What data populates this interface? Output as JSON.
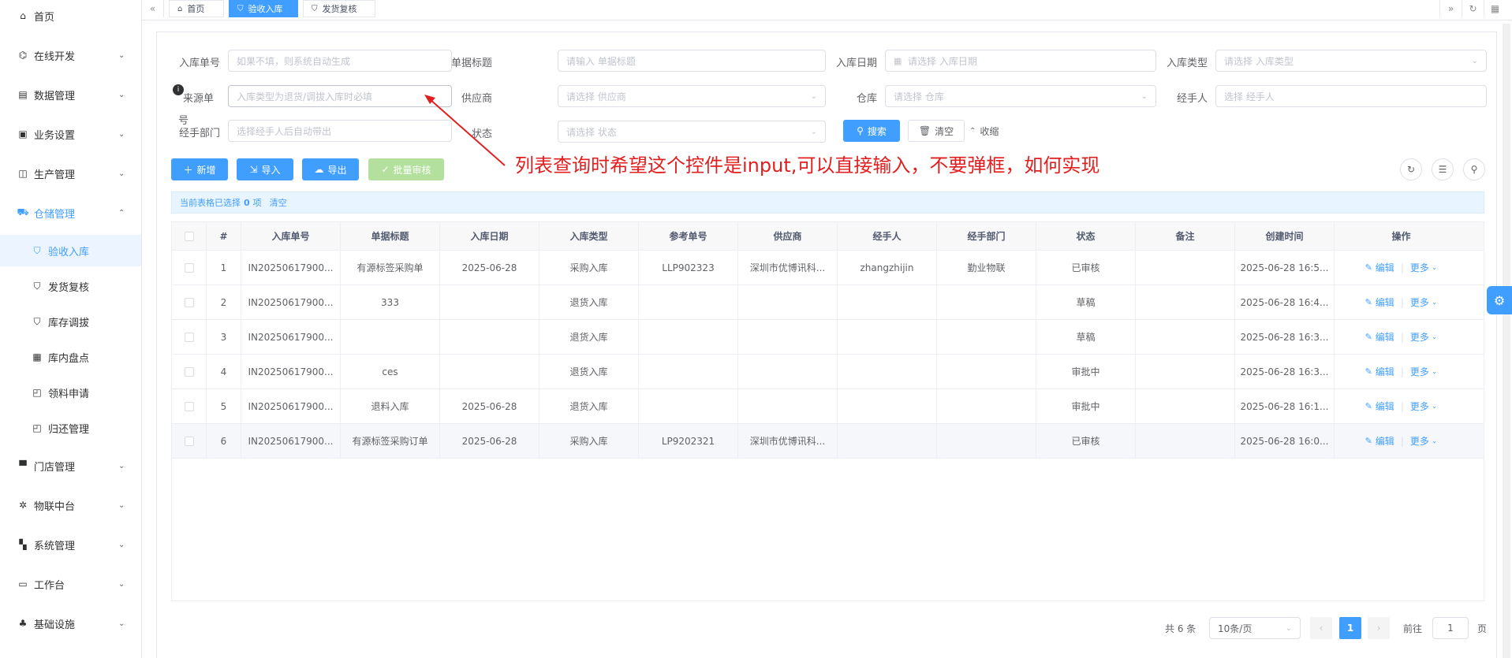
{
  "sidebar": {
    "items": [
      {
        "icon": "home-icon",
        "glyph": "⌂",
        "label": "首页",
        "expandable": false
      },
      {
        "icon": "code-icon",
        "glyph": "⌬",
        "label": "在线开发",
        "expandable": true
      },
      {
        "icon": "database-icon",
        "glyph": "▤",
        "label": "数据管理",
        "expandable": true
      },
      {
        "icon": "briefcase-icon",
        "glyph": "▣",
        "label": "业务设置",
        "expandable": true
      },
      {
        "icon": "factory-icon",
        "glyph": "◫",
        "label": "生产管理",
        "expandable": true
      },
      {
        "icon": "warehouse-icon",
        "glyph": "⛟",
        "label": "仓储管理",
        "expandable": true,
        "open": true
      },
      {
        "icon": "cart-icon",
        "glyph": "⛉",
        "label": "验收入库",
        "sub": true,
        "active": true
      },
      {
        "icon": "cart-icon",
        "glyph": "⛉",
        "label": "发货复核",
        "sub": true
      },
      {
        "icon": "cart-icon",
        "glyph": "⛉",
        "label": "库存调拔",
        "sub": true
      },
      {
        "icon": "calendar-icon",
        "glyph": "▦",
        "label": "库内盘点",
        "sub": true
      },
      {
        "icon": "bag-icon",
        "glyph": "◰",
        "label": "领料申请",
        "sub": true
      },
      {
        "icon": "bag-icon",
        "glyph": "◰",
        "label": "归还管理",
        "sub": true
      },
      {
        "icon": "store-icon",
        "glyph": "▀",
        "label": "门店管理",
        "expandable": true
      },
      {
        "icon": "iot-icon",
        "glyph": "✲",
        "label": "物联中台",
        "expandable": true
      },
      {
        "icon": "grid-icon",
        "glyph": "▚",
        "label": "系统管理",
        "expandable": true
      },
      {
        "icon": "monitor-icon",
        "glyph": "▭",
        "label": "工作台",
        "expandable": true
      },
      {
        "icon": "infrastructure-icon",
        "glyph": "♣",
        "label": "基础设施",
        "expandable": true
      }
    ]
  },
  "tabs": [
    {
      "label": "首页",
      "icon": "home-icon",
      "glyph": "⌂"
    },
    {
      "label": "验收入库",
      "icon": "cart-icon",
      "glyph": "⛉",
      "active": true
    },
    {
      "label": "发货复核",
      "icon": "cart-icon",
      "glyph": "⛉"
    }
  ],
  "filters": {
    "inbound_no": {
      "label": "入库单号",
      "placeholder": "如果不填，则系统自动生成"
    },
    "doc_title": {
      "label": "单据标题",
      "placeholder": "请输入 单据标题"
    },
    "inbound_date": {
      "label": "入库日期",
      "placeholder": "请选择 入库日期"
    },
    "inbound_type": {
      "label": "入库类型",
      "placeholder": "请选择 入库类型"
    },
    "source_no": {
      "label_1": "来源单",
      "label_2": "号",
      "placeholder": "入库类型为退货/调拔入库时必填"
    },
    "supplier": {
      "label": "供应商",
      "placeholder": "请选择 供应商"
    },
    "warehouse": {
      "label": "仓库",
      "placeholder": "请选择 仓库"
    },
    "handler": {
      "label": "经手人",
      "placeholder": "选择 经手人"
    },
    "handler_dept": {
      "label": "经手部门",
      "placeholder": "选择经手人后自动带出"
    },
    "status": {
      "label": "状态",
      "placeholder": "请选择 状态"
    },
    "search_label": "搜索",
    "clear_label": "清空",
    "collapse_label": "收缩"
  },
  "toolbar": {
    "add_label": "新增",
    "import_label": "导入",
    "export_label": "导出",
    "batch_audit_label": "批量审核"
  },
  "annotation": "列表查询时希望这个控件是input,可以直接输入，不要弹框，如何实现",
  "selection": {
    "prefix": "当前表格已选择",
    "count": "0",
    "suffix": "项",
    "clear": "清空"
  },
  "table": {
    "columns": [
      "#",
      "入库单号",
      "单据标题",
      "入库日期",
      "入库类型",
      "参考单号",
      "供应商",
      "经手人",
      "经手部门",
      "状态",
      "备注",
      "创建时间",
      "操作"
    ],
    "rows": [
      [
        "1",
        "IN20250617900...",
        "有源标签采购单",
        "2025-06-28",
        "采购入库",
        "LLP902323",
        "深圳市优博讯科...",
        "zhangzhijin",
        "勤业物联",
        "已审核",
        "",
        "2025-06-28 16:5..."
      ],
      [
        "2",
        "IN20250617900...",
        "333",
        "",
        "退货入库",
        "",
        "",
        "",
        "",
        "草稿",
        "",
        "2025-06-28 16:4..."
      ],
      [
        "3",
        "IN20250617900...",
        "",
        "",
        "退货入库",
        "",
        "",
        "",
        "",
        "草稿",
        "",
        "2025-06-28 16:3..."
      ],
      [
        "4",
        "IN20250617900...",
        "ces",
        "",
        "退货入库",
        "",
        "",
        "",
        "",
        "审批中",
        "",
        "2025-06-28 16:3..."
      ],
      [
        "5",
        "IN20250617900...",
        "退料入库",
        "2025-06-28",
        "退货入库",
        "",
        "",
        "",
        "",
        "审批中",
        "",
        "2025-06-28 16:1..."
      ],
      [
        "6",
        "IN20250617900...",
        "有源标签采购订单",
        "2025-06-28",
        "采购入库",
        "LP9202321",
        "深圳市优博讯科...",
        "",
        "",
        "已审核",
        "",
        "2025-06-28 16:0..."
      ]
    ],
    "edit_label": "编辑",
    "more_label": "更多"
  },
  "pagination": {
    "total": "共 6 条",
    "page_size": "10条/页",
    "current_page": "1",
    "goto_label": "前往",
    "goto_value": "1",
    "page_suffix": "页"
  },
  "colors": {
    "primary": "#409eff",
    "annotation": "#e02020",
    "disabled_green": "#b3e19d"
  }
}
